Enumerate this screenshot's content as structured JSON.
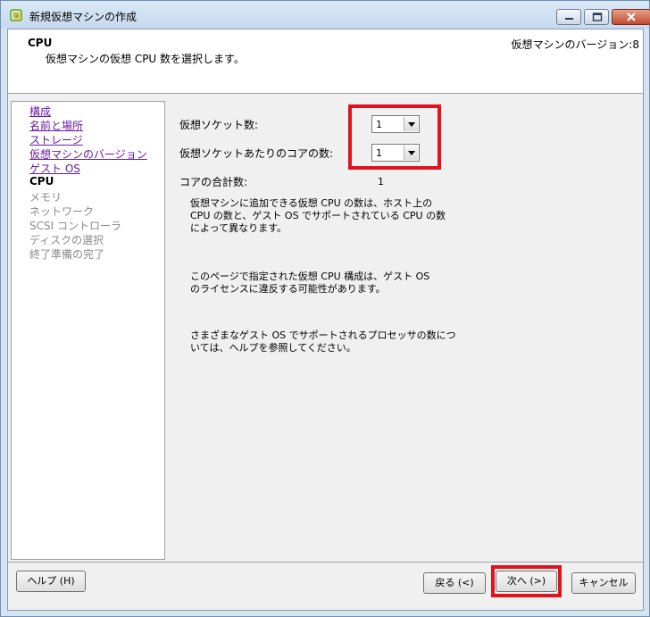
{
  "window": {
    "title": "新規仮想マシンの作成",
    "app_icon": "vsphere-icon",
    "controls": [
      "minimize-icon",
      "maximize-icon",
      "close-icon"
    ]
  },
  "header": {
    "title": "CPU",
    "description": "仮想マシンの仮想 CPU 数を選択します。",
    "version": "仮想マシンのバージョン:8"
  },
  "nav": {
    "items": [
      {
        "label": "構成",
        "state": "link"
      },
      {
        "label": "名前と場所",
        "state": "link"
      },
      {
        "label": "ストレージ",
        "state": "link"
      },
      {
        "label": "仮想マシンのバージョン",
        "state": "link"
      },
      {
        "label": "ゲスト OS",
        "state": "link"
      },
      {
        "label": "CPU",
        "state": "current"
      },
      {
        "label": "メモリ",
        "state": "disabled"
      },
      {
        "label": "ネットワーク",
        "state": "disabled"
      },
      {
        "label": "SCSI コントローラ",
        "state": "disabled"
      },
      {
        "label": "ディスクの選択",
        "state": "disabled"
      },
      {
        "label": "終了準備の完了",
        "state": "disabled"
      }
    ]
  },
  "form": {
    "sockets_label": "仮想ソケット数:",
    "sockets_value": "1",
    "cores_label": "仮想ソケットあたりのコアの数:",
    "cores_value": "1",
    "total_label": "コアの合計数:",
    "total_value": "1"
  },
  "info": {
    "p1": "仮想マシンに追加できる仮想 CPU の数は、ホスト上の\nCPU の数と、ゲスト OS でサポートされている CPU の数\nによって異なります。",
    "p2": "このページで指定された仮想 CPU 構成は、ゲスト OS\nのライセンスに違反する可能性があります。",
    "p3": "さまざまなゲスト OS でサポートされるプロセッサの数につ\nいては、ヘルプを参照してください。"
  },
  "buttons": {
    "help": "ヘルプ (H)",
    "back": "戻る (<)",
    "next": "次へ (>)",
    "cancel": "キャンセル"
  },
  "highlight_color": "#e0121d"
}
